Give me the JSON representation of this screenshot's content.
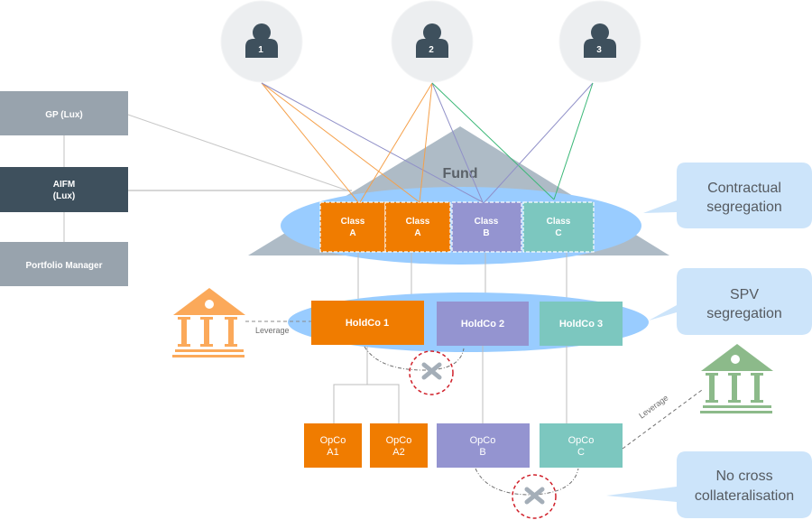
{
  "colors": {
    "orange": "#F07C00",
    "purple": "#9494D0",
    "teal": "#7CC7BF",
    "ellipse_blue": "#99CCFF",
    "callout_blue": "#CCE4FA",
    "fund_triangle": "#AEBBC6",
    "gp_box": "#98A3AD",
    "aifm_box": "#3E505D",
    "investor_circle": "#ECEEF0",
    "investor_icon": "#3E505D",
    "bank_orange": "#FBA95A",
    "bank_green": "#8CBA8A",
    "line_orange": "#F5A04A",
    "line_purple": "#9090C8",
    "line_green": "#3CB878",
    "line_grey": "#C8C8C8",
    "cross_red": "#D0202A",
    "cross_grey": "#A4AEB8"
  },
  "investors": [
    {
      "label": "1"
    },
    {
      "label": "2"
    },
    {
      "label": "3"
    }
  ],
  "governance": {
    "gp": "GP (Lux)",
    "aifm_line1": "AIFM",
    "aifm_line2": "(Lux)",
    "pm": "Portfolio Manager"
  },
  "fund": {
    "title": "Fund",
    "classes": [
      {
        "line1": "Class",
        "line2": "A"
      },
      {
        "line1": "Class",
        "line2": "A"
      },
      {
        "line1": "Class",
        "line2": "B"
      },
      {
        "line1": "Class",
        "line2": "C"
      }
    ]
  },
  "holdcos": [
    {
      "label": "HoldCo 1"
    },
    {
      "label": "HoldCo 2"
    },
    {
      "label": "HoldCo 3"
    }
  ],
  "opcos": [
    {
      "line1": "OpCo",
      "line2": "A1"
    },
    {
      "line1": "OpCo",
      "line2": "A2"
    },
    {
      "line1": "OpCo",
      "line2": "B"
    },
    {
      "line1": "OpCo",
      "line2": "C"
    }
  ],
  "leverage_left": "Leverage",
  "leverage_right": "Leverage",
  "callouts": [
    {
      "line1": "Contractual",
      "line2": "segregation"
    },
    {
      "line1": "SPV",
      "line2": "segregation"
    },
    {
      "line1": "No cross",
      "line2": "collateralisation"
    }
  ]
}
